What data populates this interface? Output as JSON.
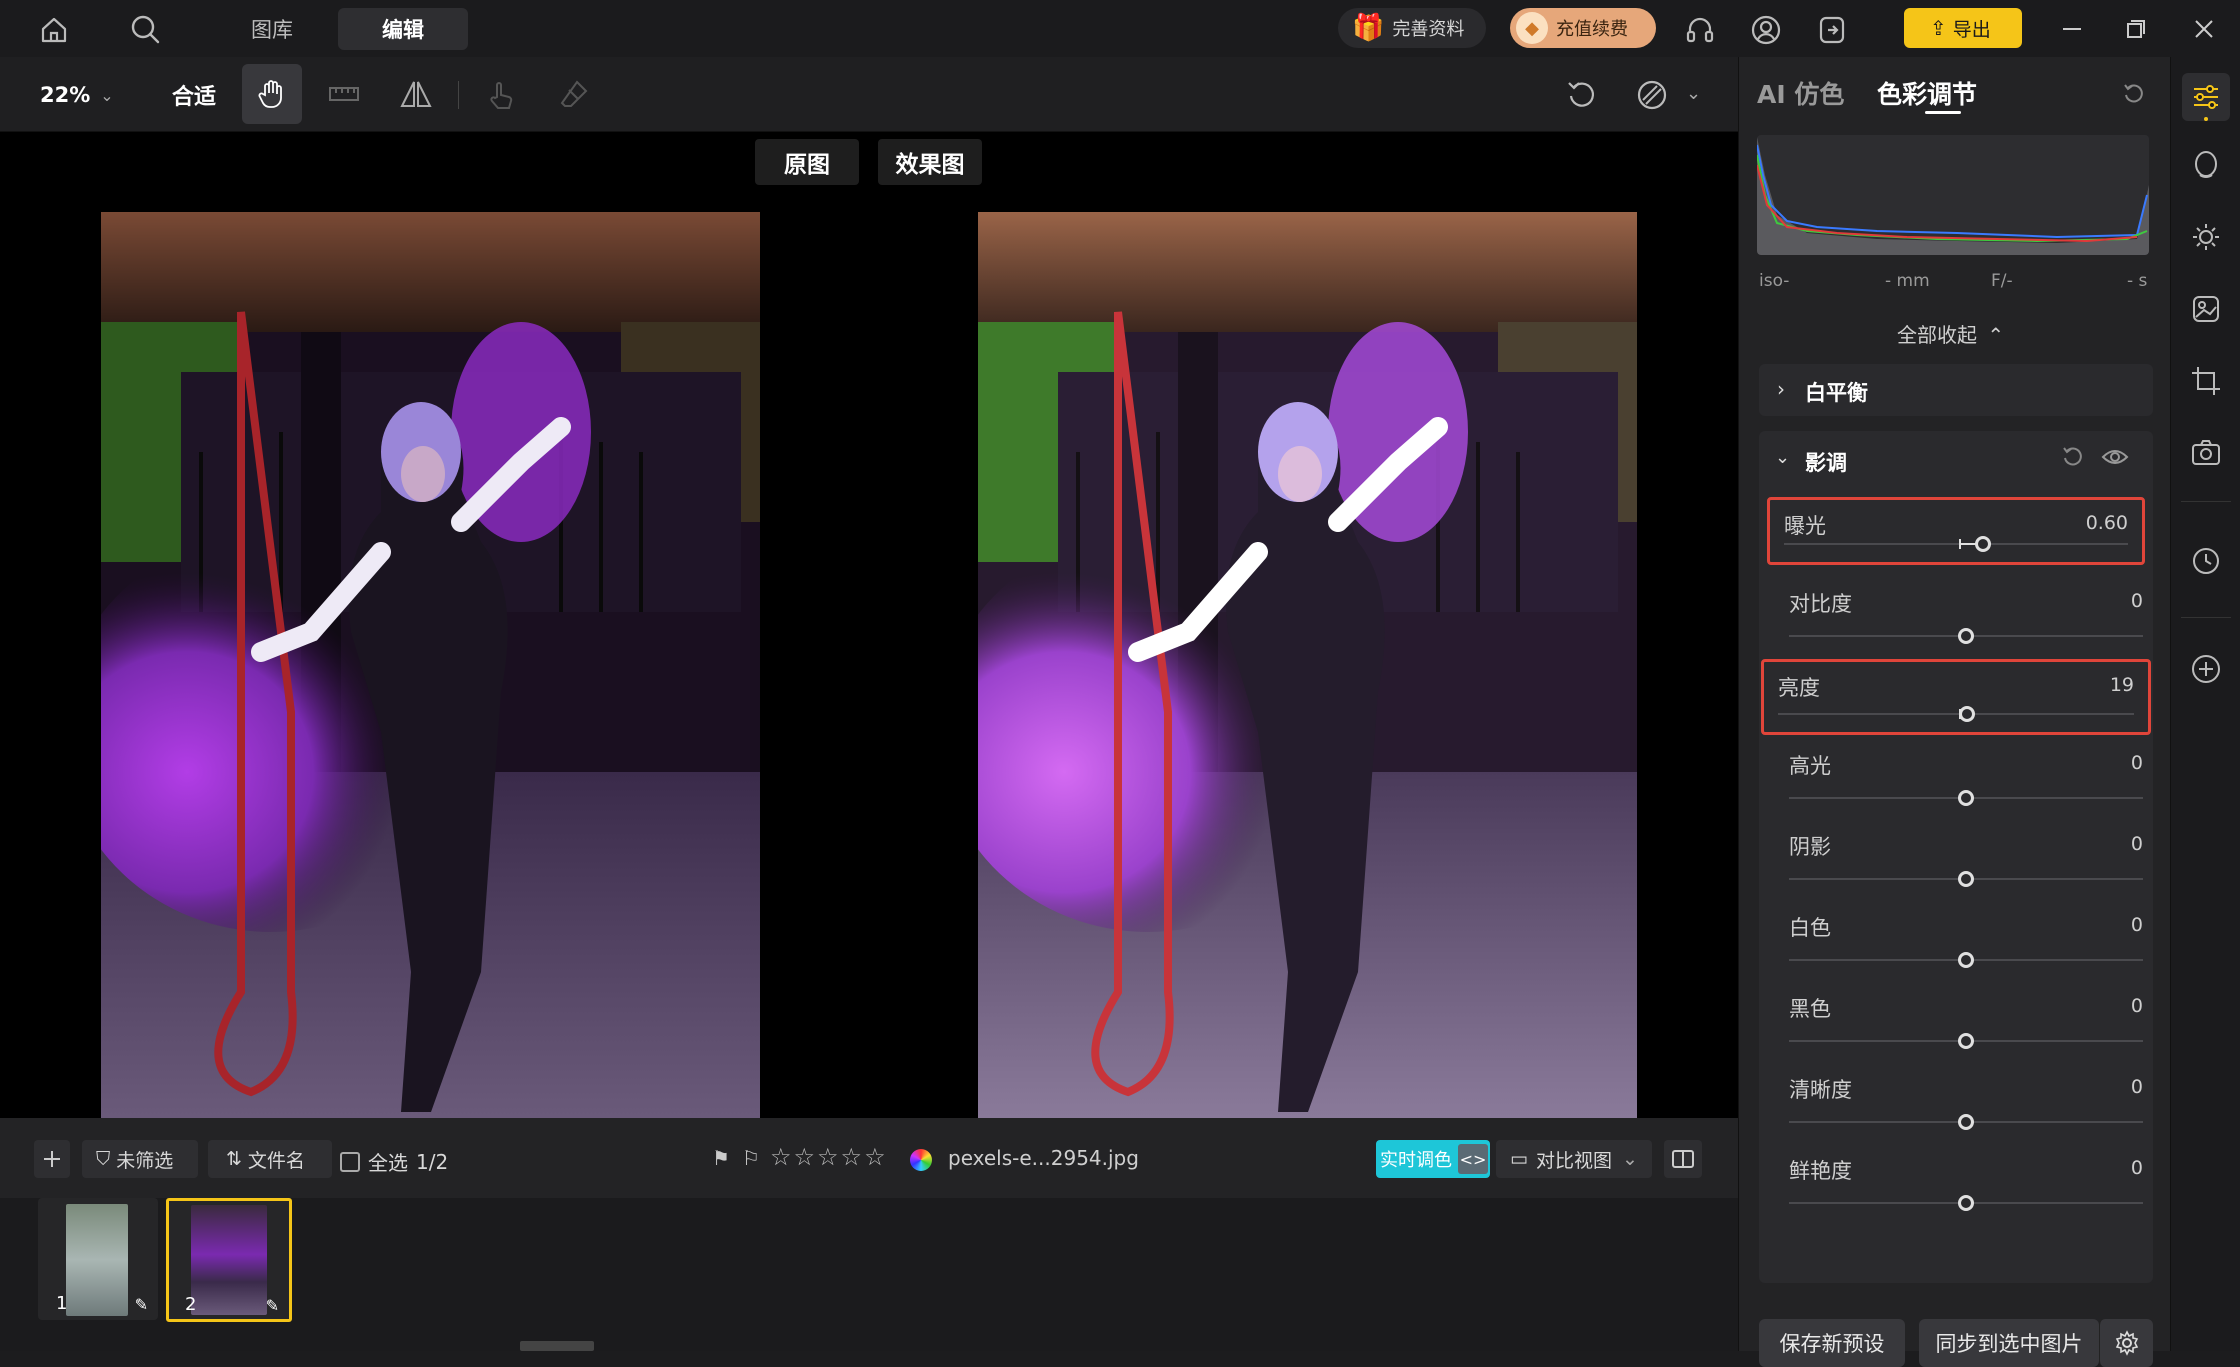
{
  "topbar": {
    "tabs": [
      {
        "label": "图库"
      },
      {
        "label": "编辑"
      }
    ],
    "profile_label": "完善资料",
    "recharge_label": "充值续费",
    "export_label": "导出"
  },
  "toolbar": {
    "zoom": "22%",
    "fit_label": "合适"
  },
  "canvas": {
    "original_label": "原图",
    "result_label": "效果图"
  },
  "filmbar": {
    "filter_label": "未筛选",
    "sort_label": "文件名",
    "select_all_label": "全选",
    "selection_count": "1/2",
    "filename": "pexels-e...2954.jpg",
    "live_color_label": "实时调色",
    "compare_view_label": "对比视图"
  },
  "filmstrip": {
    "thumbs": [
      {
        "index": "1"
      },
      {
        "index": "2"
      }
    ]
  },
  "panel": {
    "tab_ai": "AI 仿色",
    "tab_color": "色彩调节",
    "exif": {
      "iso": "iso-",
      "focal": "- mm",
      "aperture": "F/-",
      "shutter": "- s"
    },
    "collapse_all": "全部收起",
    "white_balance_title": "白平衡",
    "tone_title": "影调",
    "sliders": [
      {
        "label": "曝光",
        "value": "0.60",
        "level": 0.6
      },
      {
        "label": "对比度",
        "value": "0",
        "level": 0
      },
      {
        "label": "亮度",
        "value": "19",
        "level": 0.19
      },
      {
        "label": "高光",
        "value": "0",
        "level": 0
      },
      {
        "label": "阴影",
        "value": "0",
        "level": 0
      },
      {
        "label": "白色",
        "value": "0",
        "level": 0
      },
      {
        "label": "黑色",
        "value": "0",
        "level": 0
      },
      {
        "label": "清晰度",
        "value": "0",
        "level": 0
      },
      {
        "label": "鲜艳度",
        "value": "0",
        "level": 0
      }
    ],
    "save_preset_label": "保存新预设",
    "sync_label": "同步到选中图片"
  },
  "colors": {
    "accent_export": "#f5c518",
    "live_color": "#1ec6d8",
    "highlight_box": "#e0453a",
    "thumb_selected": "#f5c518"
  }
}
